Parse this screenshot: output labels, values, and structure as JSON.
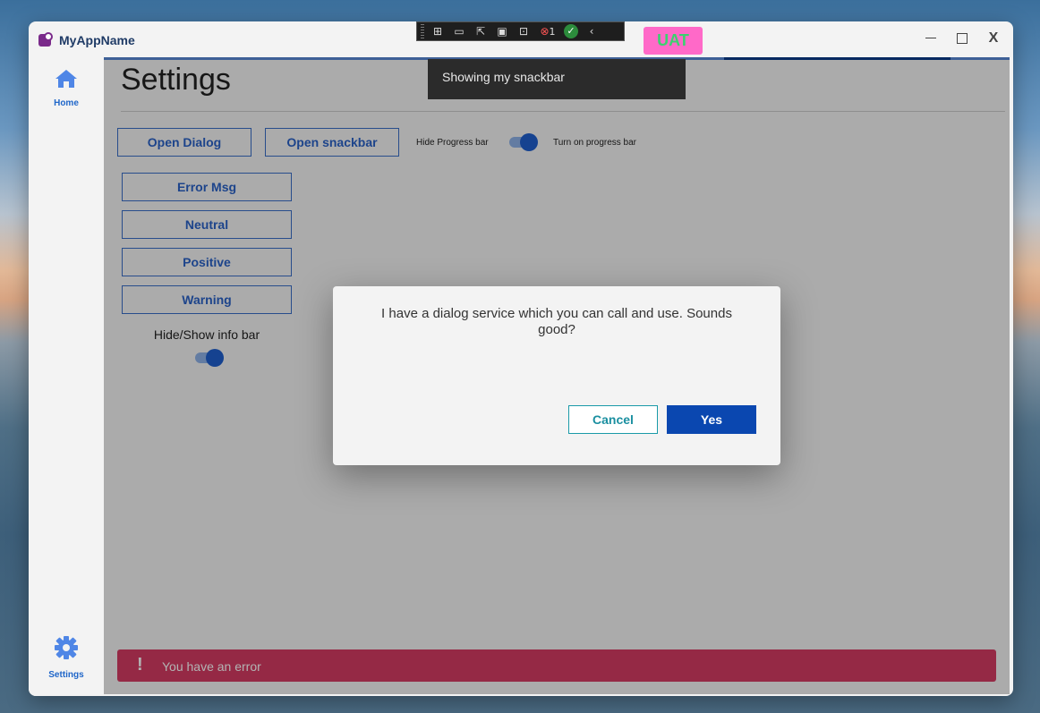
{
  "window": {
    "app_title": "MyAppName",
    "minimize_icon": "minimize-icon",
    "maximize_icon": "maximize-icon",
    "close_label": "X"
  },
  "devbar": {
    "items": [
      "live-tree-icon",
      "camera-icon",
      "select-element-icon",
      "display-layout-icon",
      "track-focus-icon",
      "binding-failures-icon",
      "hot-reload-status-icon",
      "collapse-icon"
    ],
    "binding_failures_count": "1"
  },
  "badge": {
    "label": "UAT",
    "bg": "#ff69c8",
    "fg": "#3bd16f"
  },
  "sidebar": {
    "items": [
      {
        "label": "Home",
        "icon": "home-icon"
      },
      {
        "label": "Settings",
        "icon": "gear-icon"
      }
    ]
  },
  "page": {
    "title": "Settings",
    "open_dialog": "Open Dialog",
    "open_snackbar": "Open snackbar",
    "hide_progress_label": "Hide Progress bar",
    "turn_on_progress_label": "Turn on progress bar",
    "info_buttons": [
      "Error Msg",
      "Neutral",
      "Positive",
      "Warning"
    ],
    "infobar_toggle_label": "Hide/Show info bar",
    "progress": 0.25
  },
  "infobar": {
    "text": "You have an error",
    "icon": "exclamation-icon",
    "color": "#d63c64"
  },
  "snackbar": {
    "text": "Showing my snackbar"
  },
  "dialog": {
    "message": "I have a dialog service which you can call and use. Sounds good?",
    "cancel": "Cancel",
    "yes": "Yes"
  },
  "colors": {
    "accent": "#1f5fcf",
    "primary_button": "#0a47b0"
  }
}
